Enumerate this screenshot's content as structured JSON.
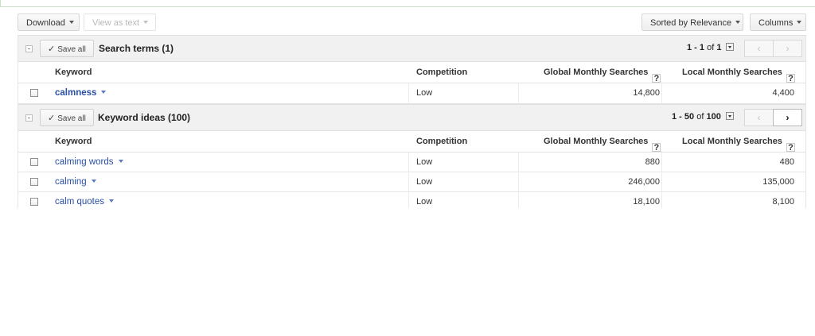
{
  "toolbar": {
    "download_label": "Download",
    "view_as_text_label": "View as text",
    "sorted_label": "Sorted by Relevance",
    "columns_label": "Columns"
  },
  "search_terms": {
    "save_all": "Save all",
    "title": "Search terms (1)",
    "pager_range": "1 - 1",
    "pager_of": "of",
    "pager_total": "1",
    "prev": "‹",
    "next": "›",
    "columns": {
      "keyword": "Keyword",
      "competition": "Competition",
      "global": "Global Monthly Searches",
      "local": "Local Monthly Searches",
      "help": "?"
    },
    "rows": [
      {
        "keyword": "calmness",
        "competition": "Low",
        "global": "14,800",
        "local": "4,400"
      }
    ]
  },
  "keyword_ideas": {
    "save_all": "Save all",
    "title": "Keyword ideas (100)",
    "pager_range": "1 - 50",
    "pager_of": "of",
    "pager_total": "100",
    "prev": "‹",
    "next": "›",
    "columns": {
      "keyword": "Keyword",
      "competition": "Competition",
      "global": "Global Monthly Searches",
      "local": "Local Monthly Searches",
      "help": "?"
    },
    "rows": [
      {
        "keyword": "calming words",
        "competition": "Low",
        "global": "880",
        "local": "480"
      },
      {
        "keyword": "calming",
        "competition": "Low",
        "global": "246,000",
        "local": "135,000"
      },
      {
        "keyword": "calm quotes",
        "competition": "Low",
        "global": "18,100",
        "local": "8,100"
      }
    ]
  },
  "colors": {
    "link": "#2a4fa6",
    "header_bg": "#f1f1f1"
  }
}
